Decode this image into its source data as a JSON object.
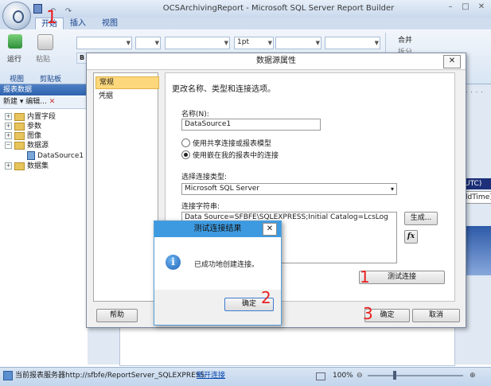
{
  "app": {
    "title": "OCSArchivingReport - Microsoft SQL Server Report Builder",
    "tabs": [
      "开始",
      "插入",
      "视图"
    ],
    "ribbon": {
      "run_label": "运行",
      "paste_label": "粘贴",
      "group_view": "视图",
      "group_clipboard": "剪贴板",
      "font_size": "1pt",
      "merge_label": "合并",
      "split_label": "拆分"
    },
    "report_data_panel": {
      "title": "报表数据",
      "new_label": "新建",
      "edit_label": "编辑...",
      "tree": [
        {
          "label": "内置字段",
          "expander": "+"
        },
        {
          "label": "参数",
          "expander": "+"
        },
        {
          "label": "图像",
          "expander": "+"
        },
        {
          "label": "数据源",
          "expander": "−"
        },
        {
          "label": "DataSource1",
          "expander": ""
        },
        {
          "label": "数据集",
          "expander": "+"
        }
      ]
    },
    "canvas_fragments": {
      "utc": "UTC)",
      "field": "ldTime]"
    },
    "status": {
      "server_label": "当前报表服务器",
      "server_url": "http://sfbfe/ReportServer_SQLEXPRESS",
      "disconnect_label": "断开连接",
      "zoom": "100%"
    }
  },
  "datasource_dialog": {
    "title": "数据源属性",
    "nav": [
      "常规",
      "凭据"
    ],
    "heading": "更改名称、类型和连接选项。",
    "name_label": "名称(N):",
    "name_value": "DataSource1",
    "radio_shared": "使用共享连接或报表模型",
    "radio_embedded": "使用嵌在我的报表中的连接",
    "type_label": "选择连接类型:",
    "type_value": "Microsoft SQL Server",
    "conn_label": "连接字符串:",
    "conn_value": "Data Source=SFBFE\\SQLEXPRESS;Initial Catalog=LcsLog",
    "build_button": "生成...",
    "fx_button": "fx",
    "test_button": "测试连接",
    "help_button": "帮助",
    "ok_button": "确定",
    "cancel_button": "取消"
  },
  "test_dialog": {
    "title": "测试连接结果",
    "message": "已成功地创建连接。",
    "ok_button": "确定"
  },
  "annotations": {
    "n1": "1",
    "n2": "2",
    "n3": "3"
  },
  "colors": {
    "accent": "#3d9ae0",
    "selection": "#fcd77b",
    "ink": "#e82020"
  }
}
